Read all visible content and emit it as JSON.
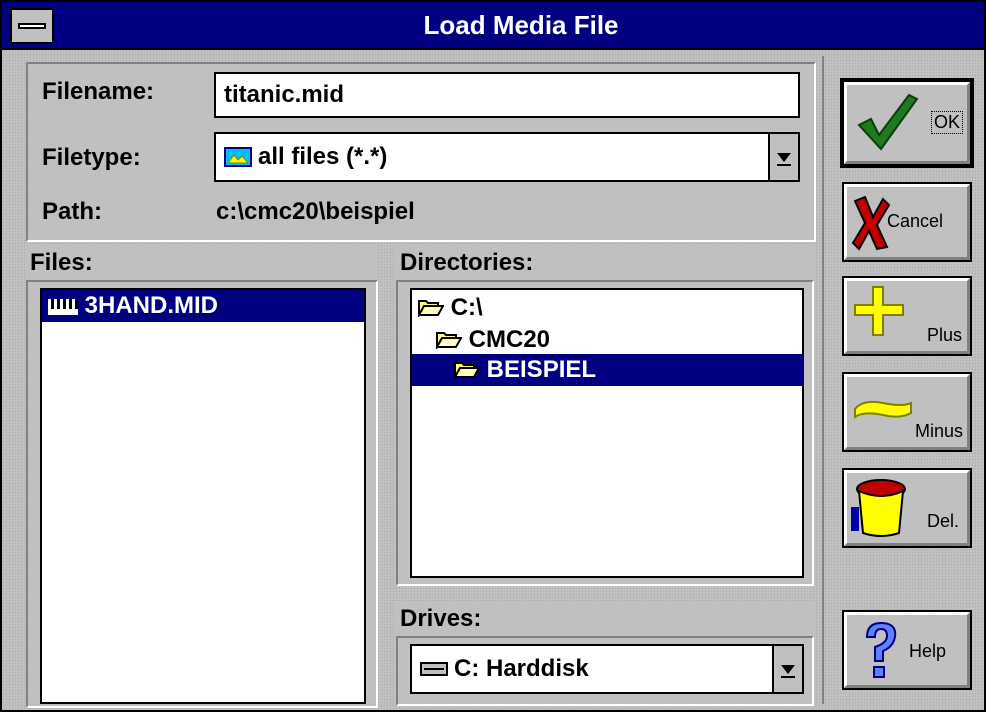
{
  "window": {
    "title": "Load Media File"
  },
  "form": {
    "filename_label": "Filename:",
    "filename_value": "titanic.mid",
    "filetype_label": "Filetype:",
    "filetype_value": "all files (*.*)",
    "path_label": "Path:",
    "path_value": "c:\\cmc20\\beispiel"
  },
  "files": {
    "label": "Files:",
    "items": [
      {
        "name": "3HAND.MID",
        "selected": true
      }
    ]
  },
  "directories": {
    "label": "Directories:",
    "items": [
      {
        "name": "C:\\",
        "selected": false
      },
      {
        "name": "CMC20",
        "selected": false
      },
      {
        "name": "BEISPIEL",
        "selected": true
      }
    ]
  },
  "drives": {
    "label": "Drives:",
    "value": "C: Harddisk"
  },
  "buttons": {
    "ok": "OK",
    "cancel": "Cancel",
    "plus": "Plus",
    "minus": "Minus",
    "del": "Del.",
    "help": "Help"
  },
  "colors": {
    "titlebar": "#000080",
    "face": "#c0c0c0",
    "selection": "#000080",
    "ok_check": "#1f7a1f",
    "cancel_x": "#c00000",
    "plus_minus": "#ffff00"
  }
}
